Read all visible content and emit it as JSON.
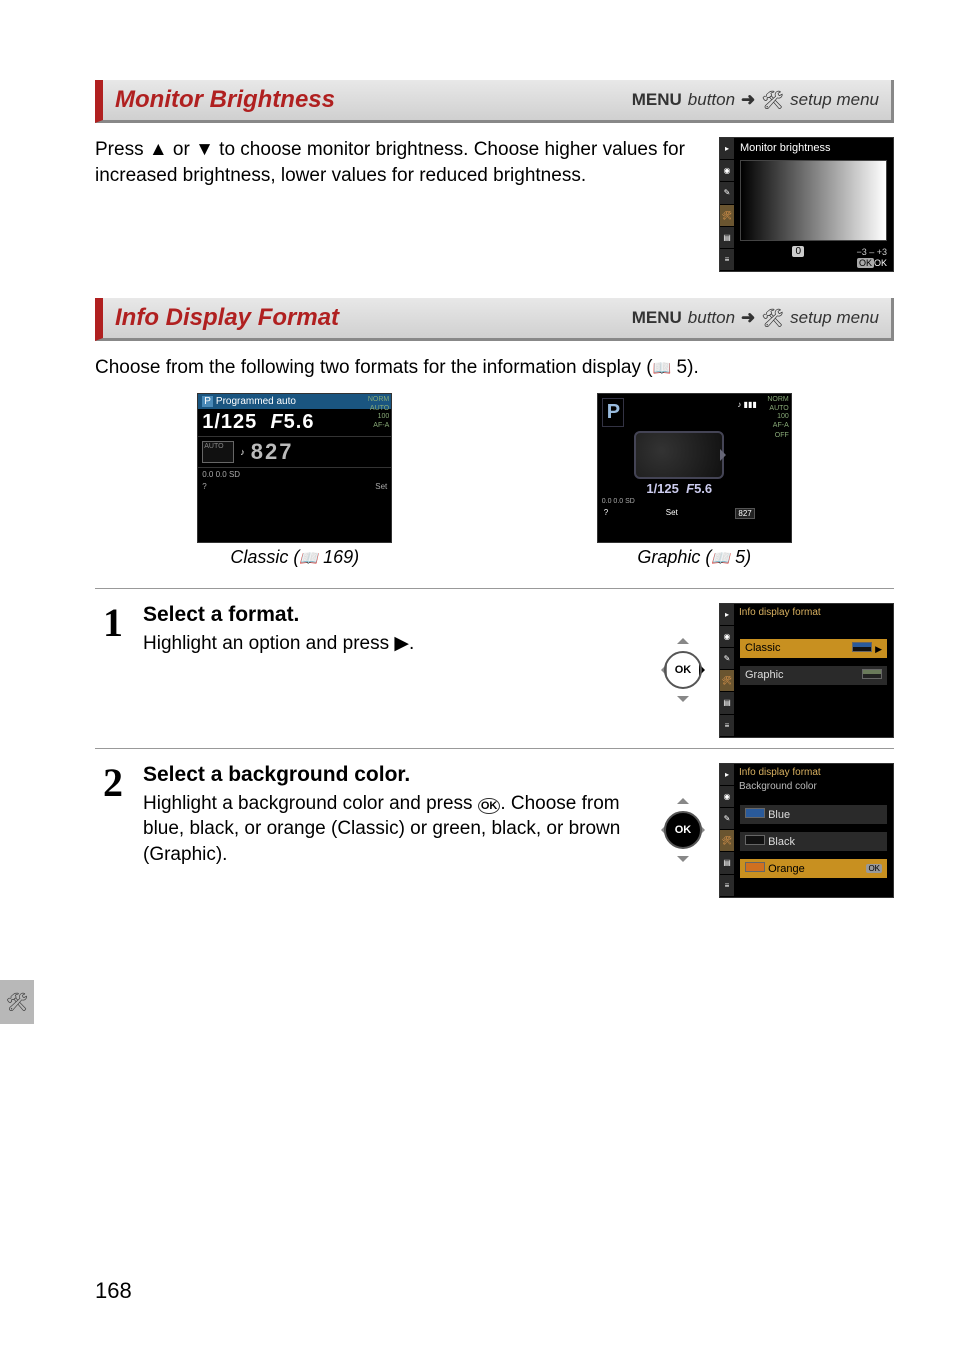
{
  "sections": {
    "monitor": {
      "title": "Monitor Brightness",
      "menu_label": "MENU",
      "button_word": "button",
      "setup_menu": "setup menu",
      "body": "Press ▲ or ▼ to choose monitor brightness. Choose higher values for increased brightness, lower values for reduced brightness.",
      "ss": {
        "title": "Monitor brightness",
        "value": "0",
        "range": "−3 – +3",
        "ok": "OK"
      }
    },
    "info": {
      "title": "Info Display Format",
      "menu_label": "MENU",
      "button_word": "button",
      "setup_menu": "setup menu",
      "intro_pre": "Choose from the following two formats for the information display (",
      "intro_page": "5).",
      "classic": {
        "caption_pre": "Classic (",
        "caption_page": "169)",
        "mode": "Programmed auto",
        "shutter": "1/125",
        "aperture_f": "F",
        "aperture": "5.6",
        "shots": "827",
        "auto_label": "AUTO",
        "bottom": "0.0   0.0  SD",
        "qset_q": "?",
        "qset_set": "Set",
        "side": [
          "NORM",
          "",
          "AUTO",
          "100",
          "",
          "AF-A",
          "",
          "",
          ""
        ]
      },
      "graphic": {
        "caption_pre": "Graphic (",
        "caption_page": "5)",
        "p": "P",
        "shutter": "1/125",
        "aperture_f": "F",
        "aperture": "5.6",
        "strip": "0.0   0.0  SD",
        "qset_q": "?",
        "qset_set": "Set",
        "shots": "827",
        "side": [
          "NORM",
          "",
          "AUTO",
          "100",
          "",
          "AF-A",
          "",
          "",
          "OFF"
        ]
      }
    },
    "steps": {
      "s1": {
        "num": "1",
        "title": "Select a format.",
        "text": "Highlight an option and press ▶.",
        "ok": "OK",
        "ss": {
          "hdr": "Info display format",
          "opt_classic": "Classic",
          "opt_graphic": "Graphic"
        }
      },
      "s2": {
        "num": "2",
        "title": "Select a background color.",
        "text_pre": "Highlight a background color and press ",
        "text_post": ". Choose from blue, black, or orange (Classic) or green, black, or brown (Graphic).",
        "ok": "OK",
        "ss": {
          "hdr": "Info display format",
          "sub": "Background color",
          "opt_blue": "Blue",
          "opt_black": "Black",
          "opt_orange": "Orange",
          "ok": "OK"
        }
      }
    }
  },
  "page_number": "168"
}
